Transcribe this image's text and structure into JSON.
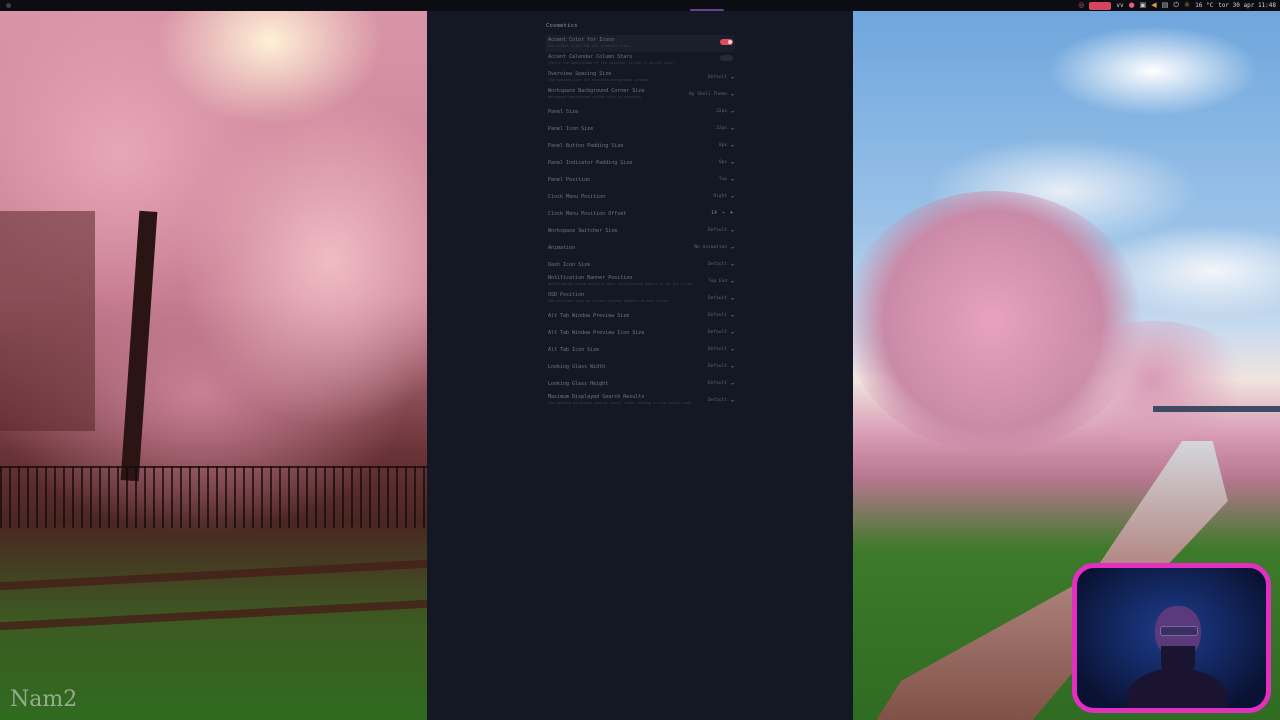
{
  "topbar": {
    "tray": {
      "indicator_label": "vv",
      "temperature": "16 °C",
      "datetime": "tor 30 apr 11:48"
    }
  },
  "wallpaper": {
    "watermark": "Nam2"
  },
  "settings": {
    "heading": "Cosmetics",
    "rows": [
      {
        "label": "Accent Color for Icons",
        "desc": "Use accent color for all symbolic icons",
        "control": "toggle-on"
      },
      {
        "label": "Accent Calendar Column Stars",
        "desc": "Starts the weekcolumn of the calendar filled in accent color",
        "control": "toggle-off"
      },
      {
        "label": "Overview Spacing Size",
        "desc": "The spacing size for overview background windows",
        "value": "Default",
        "control": "select"
      },
      {
        "label": "Workspace Background Corner Size",
        "desc": "Workspace background corner size in overview",
        "value": "By Shell Theme",
        "control": "select"
      },
      {
        "label": "Panel Size",
        "value": "32px",
        "control": "select"
      },
      {
        "label": "Panel Icon Size",
        "value": "32px",
        "control": "select"
      },
      {
        "label": "Panel Button Padding Size",
        "value": "0px",
        "control": "select"
      },
      {
        "label": "Panel Indicator Padding Size",
        "value": "0px",
        "control": "select"
      },
      {
        "label": "Panel Position",
        "value": "Top",
        "control": "select"
      },
      {
        "label": "Clock Menu Position",
        "value": "Right",
        "control": "select"
      },
      {
        "label": "Clock Menu Position Offset",
        "value": "14",
        "control": "stepper"
      },
      {
        "label": "Workspace Switcher Size",
        "value": "Default",
        "control": "select"
      },
      {
        "label": "Animation",
        "value": "No Animation",
        "control": "select"
      },
      {
        "label": "Dash Icon Size",
        "value": "Default",
        "control": "select"
      },
      {
        "label": "Notification Banner Position",
        "desc": "Notification popup position when notification banner is on the screen",
        "value": "Top End",
        "control": "select"
      },
      {
        "label": "OSD Position",
        "desc": "OSD position when on-screen display appears on the screen",
        "value": "Default",
        "control": "select"
      },
      {
        "label": "Alt Tab Window Preview Size",
        "value": "Default",
        "control": "select"
      },
      {
        "label": "Alt Tab Window Preview Icon Size",
        "value": "Default",
        "control": "select"
      },
      {
        "label": "Alt Tab Icon Size",
        "value": "Default",
        "control": "select"
      },
      {
        "label": "Looking Glass Width",
        "value": "Default",
        "control": "select"
      },
      {
        "label": "Looking Glass Height",
        "value": "Default",
        "control": "select"
      },
      {
        "label": "Maximum Displayed Search Results",
        "desc": "The maximum displayed search result items showing in the search view",
        "value": "Default",
        "control": "select"
      }
    ]
  },
  "colors": {
    "accent": "#e24b5c",
    "webcam_border": "#e22fc0",
    "panel_bg": "#141824"
  }
}
